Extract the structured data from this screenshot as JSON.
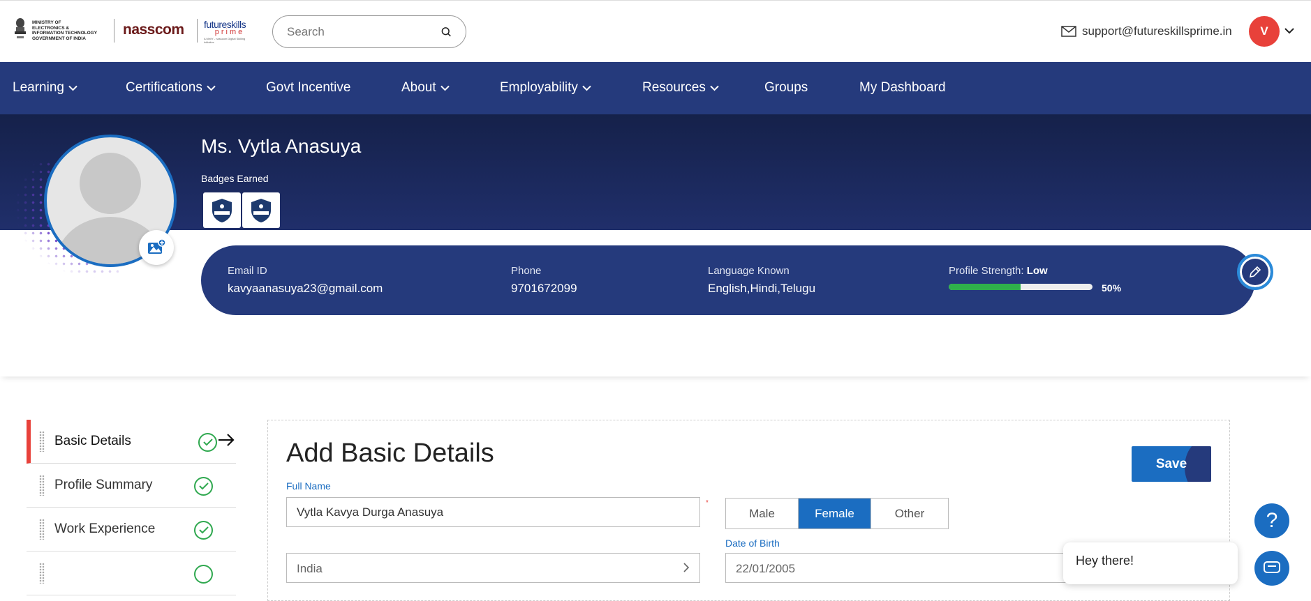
{
  "header": {
    "ministry_lines": [
      "MINISTRY OF",
      "ELECTRONICS &",
      "INFORMATION TECHNOLOGY",
      "GOVERNMENT OF INDIA"
    ],
    "nasscom": "nasscom",
    "fsp_title": "futureskills",
    "fsp_sub": "prime",
    "fsp_tagline": "A MeitY - nasscom Digital Skilling Initiative",
    "search_placeholder": "Search",
    "support_email": "support@futureskillsprime.in",
    "avatar_initial": "V"
  },
  "nav": [
    "Learning",
    "Certifications",
    "Govt Incentive",
    "About",
    "Employability",
    "Resources",
    "Groups",
    "My Dashboard"
  ],
  "profile": {
    "name": "Ms. Vytla Anasuya",
    "badges_label": "Badges Earned",
    "email_label": "Email ID",
    "email": "kavyaanasuya23@gmail.com",
    "phone_label": "Phone",
    "phone": "9701672099",
    "language_label": "Language Known",
    "languages": "English,Hindi,Telugu",
    "strength_label": "Profile Strength:",
    "strength_value": "Low",
    "strength_percent": 50,
    "strength_percent_text": "50%"
  },
  "menu": [
    {
      "label": "Basic Details",
      "active": true
    },
    {
      "label": "Profile Summary",
      "active": false
    },
    {
      "label": "Work Experience",
      "active": false
    }
  ],
  "form": {
    "title": "Add Basic Details",
    "save_label": "Save",
    "full_name_label": "Full Name",
    "full_name_value": "Vytla Kavya Durga Anasuya",
    "required_mark": "*",
    "gender_options": [
      "Male",
      "Female",
      "Other"
    ],
    "gender_selected": "Female",
    "country_value": "India",
    "dob_label": "Date of Birth",
    "dob_value": "22/01/2005"
  },
  "chat": {
    "help_symbol": "?",
    "greeting": "Hey there!"
  },
  "colors": {
    "nav_bg": "#253a7c",
    "accent_blue": "#1b6dc1",
    "accent_red": "#e8413a",
    "success_green": "#2fa84f"
  }
}
